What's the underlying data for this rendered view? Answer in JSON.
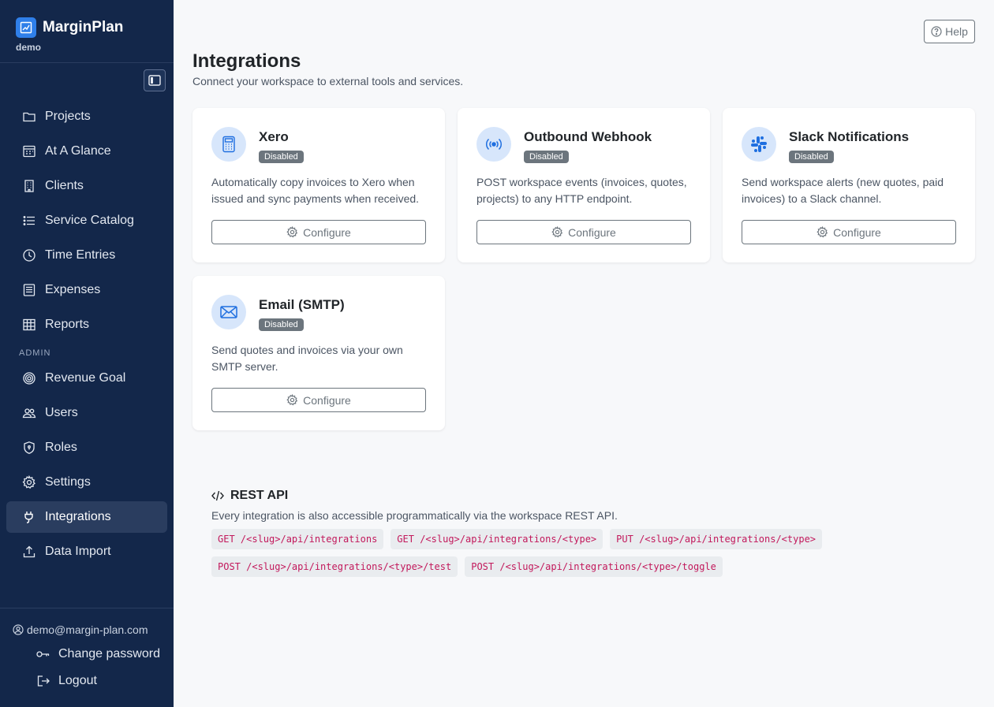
{
  "brand": {
    "name": "MarginPlan",
    "workspace": "demo"
  },
  "nav": {
    "items": [
      {
        "label": "Projects"
      },
      {
        "label": "At A Glance"
      },
      {
        "label": "Clients"
      },
      {
        "label": "Service Catalog"
      },
      {
        "label": "Time Entries"
      },
      {
        "label": "Expenses"
      },
      {
        "label": "Reports"
      }
    ],
    "admin_label": "ADMIN",
    "admin_items": [
      {
        "label": "Revenue Goal"
      },
      {
        "label": "Users"
      },
      {
        "label": "Roles"
      },
      {
        "label": "Settings"
      },
      {
        "label": "Integrations"
      },
      {
        "label": "Data Import"
      }
    ]
  },
  "footer": {
    "user_email": "demo@margin-plan.com",
    "change_password": "Change password",
    "logout": "Logout"
  },
  "header": {
    "help_label": "Help"
  },
  "page": {
    "title": "Integrations",
    "subtitle": "Connect your workspace to external tools and services."
  },
  "integrations": [
    {
      "name": "Xero",
      "status": "Disabled",
      "description": "Automatically copy invoices to Xero when issued and sync payments when received.",
      "button": "Configure",
      "icon": "calculator-icon"
    },
    {
      "name": "Outbound Webhook",
      "status": "Disabled",
      "description": "POST workspace events (invoices, quotes, projects) to any HTTP endpoint.",
      "button": "Configure",
      "icon": "broadcast-icon"
    },
    {
      "name": "Slack Notifications",
      "status": "Disabled",
      "description": "Send workspace alerts (new quotes, paid invoices) to a Slack channel.",
      "button": "Configure",
      "icon": "slack-icon"
    },
    {
      "name": "Email (SMTP)",
      "status": "Disabled",
      "description": "Send quotes and invoices via your own SMTP server.",
      "button": "Configure",
      "icon": "envelope-icon"
    }
  ],
  "api": {
    "title": "REST API",
    "description": "Every integration is also accessible programmatically via the workspace REST API.",
    "endpoints": [
      "GET /<slug>/api/integrations",
      "GET /<slug>/api/integrations/<type>",
      "PUT /<slug>/api/integrations/<type>",
      "POST /<slug>/api/integrations/<type>/test",
      "POST /<slug>/api/integrations/<type>/toggle"
    ]
  },
  "colors": {
    "sidebar": "#13274a",
    "accent": "#2f7fe9",
    "badge": "#6c757d",
    "code": "#c2185b"
  }
}
